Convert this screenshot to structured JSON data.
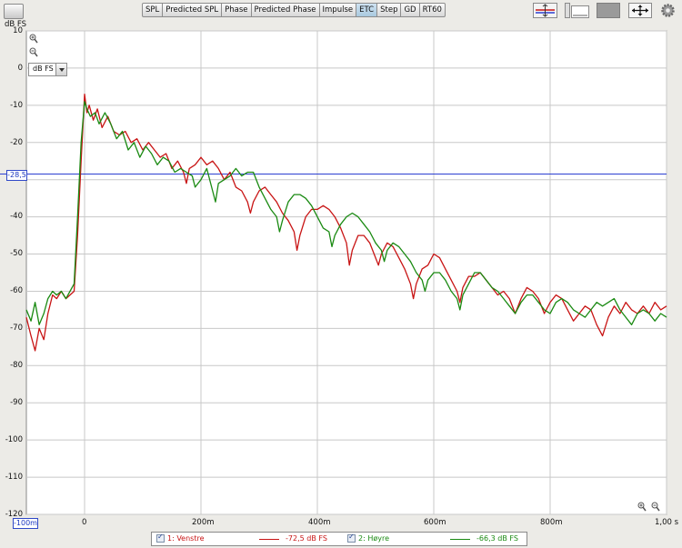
{
  "toolbar": {
    "tabs": [
      {
        "label": "SPL",
        "active": false
      },
      {
        "label": "Predicted SPL",
        "active": false
      },
      {
        "label": "Phase",
        "active": false
      },
      {
        "label": "Predicted Phase",
        "active": false
      },
      {
        "label": "Impulse",
        "active": false
      },
      {
        "label": "ETC",
        "active": true
      },
      {
        "label": "Step",
        "active": false
      },
      {
        "label": "GD",
        "active": false
      },
      {
        "label": "RT60",
        "active": false
      }
    ],
    "icons": [
      "app-icon",
      "trace-arrange-icon",
      "graph-controls-icon",
      "gray-panel-icon",
      "fit-arrows-icon",
      "settings-gear-icon"
    ]
  },
  "plot": {
    "y_unit_label": "dB FS",
    "y_ticks": [
      "10",
      "0",
      "-10",
      "-20",
      "-30",
      "-40",
      "-50",
      "-60",
      "-70",
      "-80",
      "-90",
      "-100",
      "-110",
      "-120"
    ],
    "x_ticks": [
      "0",
      "200m",
      "400m",
      "600m",
      "800m",
      "1,00 s"
    ],
    "unit_select_value": "dB FS",
    "cursor_y_value": "-28,5",
    "cursor_x_value": "-100m",
    "cursor_color": "#2b3fd1"
  },
  "chart_data": {
    "type": "line",
    "xlabel": "",
    "ylabel": "dB FS",
    "xlim": [
      -0.1,
      1.0
    ],
    "ylim": [
      -120,
      10
    ],
    "grid": true,
    "horizontal_cursor": -28.5,
    "series": [
      {
        "name": "1: Venstre",
        "color": "#c81414",
        "points": [
          [
            -0.1,
            -67
          ],
          [
            -0.092,
            -72
          ],
          [
            -0.085,
            -76
          ],
          [
            -0.078,
            -70
          ],
          [
            -0.07,
            -73
          ],
          [
            -0.063,
            -66
          ],
          [
            -0.055,
            -61
          ],
          [
            -0.048,
            -62
          ],
          [
            -0.04,
            -60
          ],
          [
            -0.032,
            -62
          ],
          [
            -0.025,
            -61
          ],
          [
            -0.018,
            -60
          ],
          [
            -0.012,
            -45
          ],
          [
            -0.006,
            -25
          ],
          [
            0.0,
            -7
          ],
          [
            0.004,
            -12
          ],
          [
            0.008,
            -10
          ],
          [
            0.015,
            -14
          ],
          [
            0.022,
            -11
          ],
          [
            0.03,
            -16
          ],
          [
            0.04,
            -13
          ],
          [
            0.05,
            -17
          ],
          [
            0.06,
            -18
          ],
          [
            0.07,
            -17
          ],
          [
            0.08,
            -20
          ],
          [
            0.09,
            -19
          ],
          [
            0.1,
            -22
          ],
          [
            0.11,
            -20
          ],
          [
            0.12,
            -22
          ],
          [
            0.13,
            -24
          ],
          [
            0.14,
            -23
          ],
          [
            0.15,
            -27
          ],
          [
            0.16,
            -25
          ],
          [
            0.17,
            -28
          ],
          [
            0.175,
            -31
          ],
          [
            0.18,
            -27
          ],
          [
            0.19,
            -26
          ],
          [
            0.2,
            -24
          ],
          [
            0.21,
            -26
          ],
          [
            0.22,
            -25
          ],
          [
            0.23,
            -27
          ],
          [
            0.24,
            -30
          ],
          [
            0.25,
            -28
          ],
          [
            0.26,
            -32
          ],
          [
            0.27,
            -33
          ],
          [
            0.28,
            -36
          ],
          [
            0.285,
            -39
          ],
          [
            0.29,
            -36
          ],
          [
            0.3,
            -33
          ],
          [
            0.31,
            -32
          ],
          [
            0.32,
            -34
          ],
          [
            0.33,
            -36
          ],
          [
            0.34,
            -39
          ],
          [
            0.35,
            -41
          ],
          [
            0.36,
            -44
          ],
          [
            0.365,
            -49
          ],
          [
            0.37,
            -45
          ],
          [
            0.38,
            -40
          ],
          [
            0.39,
            -38
          ],
          [
            0.4,
            -38
          ],
          [
            0.41,
            -37
          ],
          [
            0.42,
            -38
          ],
          [
            0.43,
            -40
          ],
          [
            0.44,
            -43
          ],
          [
            0.45,
            -47
          ],
          [
            0.455,
            -53
          ],
          [
            0.46,
            -49
          ],
          [
            0.47,
            -45
          ],
          [
            0.48,
            -45
          ],
          [
            0.49,
            -47
          ],
          [
            0.5,
            -51
          ],
          [
            0.505,
            -53
          ],
          [
            0.51,
            -50
          ],
          [
            0.52,
            -47
          ],
          [
            0.53,
            -48
          ],
          [
            0.54,
            -51
          ],
          [
            0.55,
            -54
          ],
          [
            0.56,
            -58
          ],
          [
            0.565,
            -62
          ],
          [
            0.57,
            -58
          ],
          [
            0.58,
            -54
          ],
          [
            0.59,
            -53
          ],
          [
            0.6,
            -50
          ],
          [
            0.61,
            -51
          ],
          [
            0.62,
            -54
          ],
          [
            0.63,
            -57
          ],
          [
            0.64,
            -60
          ],
          [
            0.645,
            -63
          ],
          [
            0.65,
            -59
          ],
          [
            0.66,
            -56
          ],
          [
            0.67,
            -56
          ],
          [
            0.68,
            -55
          ],
          [
            0.69,
            -57
          ],
          [
            0.7,
            -59
          ],
          [
            0.71,
            -61
          ],
          [
            0.72,
            -60
          ],
          [
            0.73,
            -62
          ],
          [
            0.74,
            -66
          ],
          [
            0.75,
            -62
          ],
          [
            0.76,
            -59
          ],
          [
            0.77,
            -60
          ],
          [
            0.78,
            -62
          ],
          [
            0.79,
            -66
          ],
          [
            0.8,
            -63
          ],
          [
            0.81,
            -61
          ],
          [
            0.82,
            -62
          ],
          [
            0.83,
            -65
          ],
          [
            0.84,
            -68
          ],
          [
            0.85,
            -66
          ],
          [
            0.86,
            -64
          ],
          [
            0.87,
            -65
          ],
          [
            0.88,
            -69
          ],
          [
            0.89,
            -72
          ],
          [
            0.9,
            -67
          ],
          [
            0.91,
            -64
          ],
          [
            0.92,
            -66
          ],
          [
            0.93,
            -63
          ],
          [
            0.94,
            -65
          ],
          [
            0.95,
            -66
          ],
          [
            0.96,
            -64
          ],
          [
            0.97,
            -66
          ],
          [
            0.98,
            -63
          ],
          [
            0.99,
            -65
          ],
          [
            1.0,
            -64
          ]
        ]
      },
      {
        "name": "2: Høyre",
        "color": "#1a8a12",
        "points": [
          [
            -0.1,
            -65
          ],
          [
            -0.092,
            -68
          ],
          [
            -0.085,
            -63
          ],
          [
            -0.078,
            -69
          ],
          [
            -0.07,
            -66
          ],
          [
            -0.063,
            -62
          ],
          [
            -0.055,
            -60
          ],
          [
            -0.048,
            -61
          ],
          [
            -0.04,
            -60
          ],
          [
            -0.032,
            -62
          ],
          [
            -0.025,
            -60
          ],
          [
            -0.018,
            -58
          ],
          [
            -0.012,
            -40
          ],
          [
            -0.006,
            -20
          ],
          [
            0.0,
            -9
          ],
          [
            0.004,
            -11
          ],
          [
            0.01,
            -13
          ],
          [
            0.018,
            -12
          ],
          [
            0.025,
            -15
          ],
          [
            0.035,
            -12
          ],
          [
            0.045,
            -15
          ],
          [
            0.055,
            -19
          ],
          [
            0.065,
            -17
          ],
          [
            0.075,
            -22
          ],
          [
            0.085,
            -20
          ],
          [
            0.095,
            -24
          ],
          [
            0.105,
            -21
          ],
          [
            0.115,
            -23
          ],
          [
            0.125,
            -26
          ],
          [
            0.135,
            -24
          ],
          [
            0.145,
            -25
          ],
          [
            0.155,
            -28
          ],
          [
            0.165,
            -27
          ],
          [
            0.175,
            -28
          ],
          [
            0.185,
            -29
          ],
          [
            0.19,
            -32
          ],
          [
            0.2,
            -30
          ],
          [
            0.21,
            -27
          ],
          [
            0.22,
            -33
          ],
          [
            0.225,
            -36
          ],
          [
            0.23,
            -31
          ],
          [
            0.24,
            -30
          ],
          [
            0.25,
            -29
          ],
          [
            0.26,
            -27
          ],
          [
            0.27,
            -29
          ],
          [
            0.28,
            -28
          ],
          [
            0.29,
            -28
          ],
          [
            0.3,
            -32
          ],
          [
            0.31,
            -35
          ],
          [
            0.32,
            -38
          ],
          [
            0.33,
            -40
          ],
          [
            0.335,
            -44
          ],
          [
            0.34,
            -41
          ],
          [
            0.35,
            -36
          ],
          [
            0.36,
            -34
          ],
          [
            0.37,
            -34
          ],
          [
            0.38,
            -35
          ],
          [
            0.39,
            -37
          ],
          [
            0.4,
            -40
          ],
          [
            0.41,
            -43
          ],
          [
            0.42,
            -44
          ],
          [
            0.425,
            -48
          ],
          [
            0.43,
            -45
          ],
          [
            0.44,
            -42
          ],
          [
            0.45,
            -40
          ],
          [
            0.46,
            -39
          ],
          [
            0.47,
            -40
          ],
          [
            0.48,
            -42
          ],
          [
            0.49,
            -44
          ],
          [
            0.5,
            -47
          ],
          [
            0.51,
            -49
          ],
          [
            0.515,
            -52
          ],
          [
            0.52,
            -49
          ],
          [
            0.53,
            -47
          ],
          [
            0.54,
            -48
          ],
          [
            0.55,
            -50
          ],
          [
            0.56,
            -52
          ],
          [
            0.57,
            -55
          ],
          [
            0.58,
            -57
          ],
          [
            0.585,
            -60
          ],
          [
            0.59,
            -57
          ],
          [
            0.6,
            -55
          ],
          [
            0.61,
            -55
          ],
          [
            0.62,
            -57
          ],
          [
            0.63,
            -60
          ],
          [
            0.64,
            -62
          ],
          [
            0.645,
            -65
          ],
          [
            0.65,
            -61
          ],
          [
            0.66,
            -58
          ],
          [
            0.67,
            -55
          ],
          [
            0.68,
            -55
          ],
          [
            0.69,
            -57
          ],
          [
            0.7,
            -59
          ],
          [
            0.71,
            -60
          ],
          [
            0.72,
            -62
          ],
          [
            0.73,
            -64
          ],
          [
            0.74,
            -66
          ],
          [
            0.75,
            -63
          ],
          [
            0.76,
            -61
          ],
          [
            0.77,
            -61
          ],
          [
            0.78,
            -63
          ],
          [
            0.79,
            -65
          ],
          [
            0.8,
            -66
          ],
          [
            0.81,
            -63
          ],
          [
            0.82,
            -62
          ],
          [
            0.83,
            -63
          ],
          [
            0.84,
            -65
          ],
          [
            0.85,
            -66
          ],
          [
            0.86,
            -67
          ],
          [
            0.87,
            -65
          ],
          [
            0.88,
            -63
          ],
          [
            0.89,
            -64
          ],
          [
            0.9,
            -63
          ],
          [
            0.91,
            -62
          ],
          [
            0.92,
            -65
          ],
          [
            0.93,
            -67
          ],
          [
            0.94,
            -69
          ],
          [
            0.95,
            -66
          ],
          [
            0.96,
            -65
          ],
          [
            0.97,
            -66
          ],
          [
            0.98,
            -68
          ],
          [
            0.99,
            -66
          ],
          [
            1.0,
            -67
          ]
        ]
      }
    ]
  },
  "legend": {
    "items": [
      {
        "label": "1: Venstre",
        "value": "-72,5 dB FS",
        "color": "#c81414",
        "checked": true
      },
      {
        "label": "2: Høyre",
        "value": "-66,3 dB FS",
        "color": "#1a8a12",
        "checked": true
      }
    ]
  }
}
